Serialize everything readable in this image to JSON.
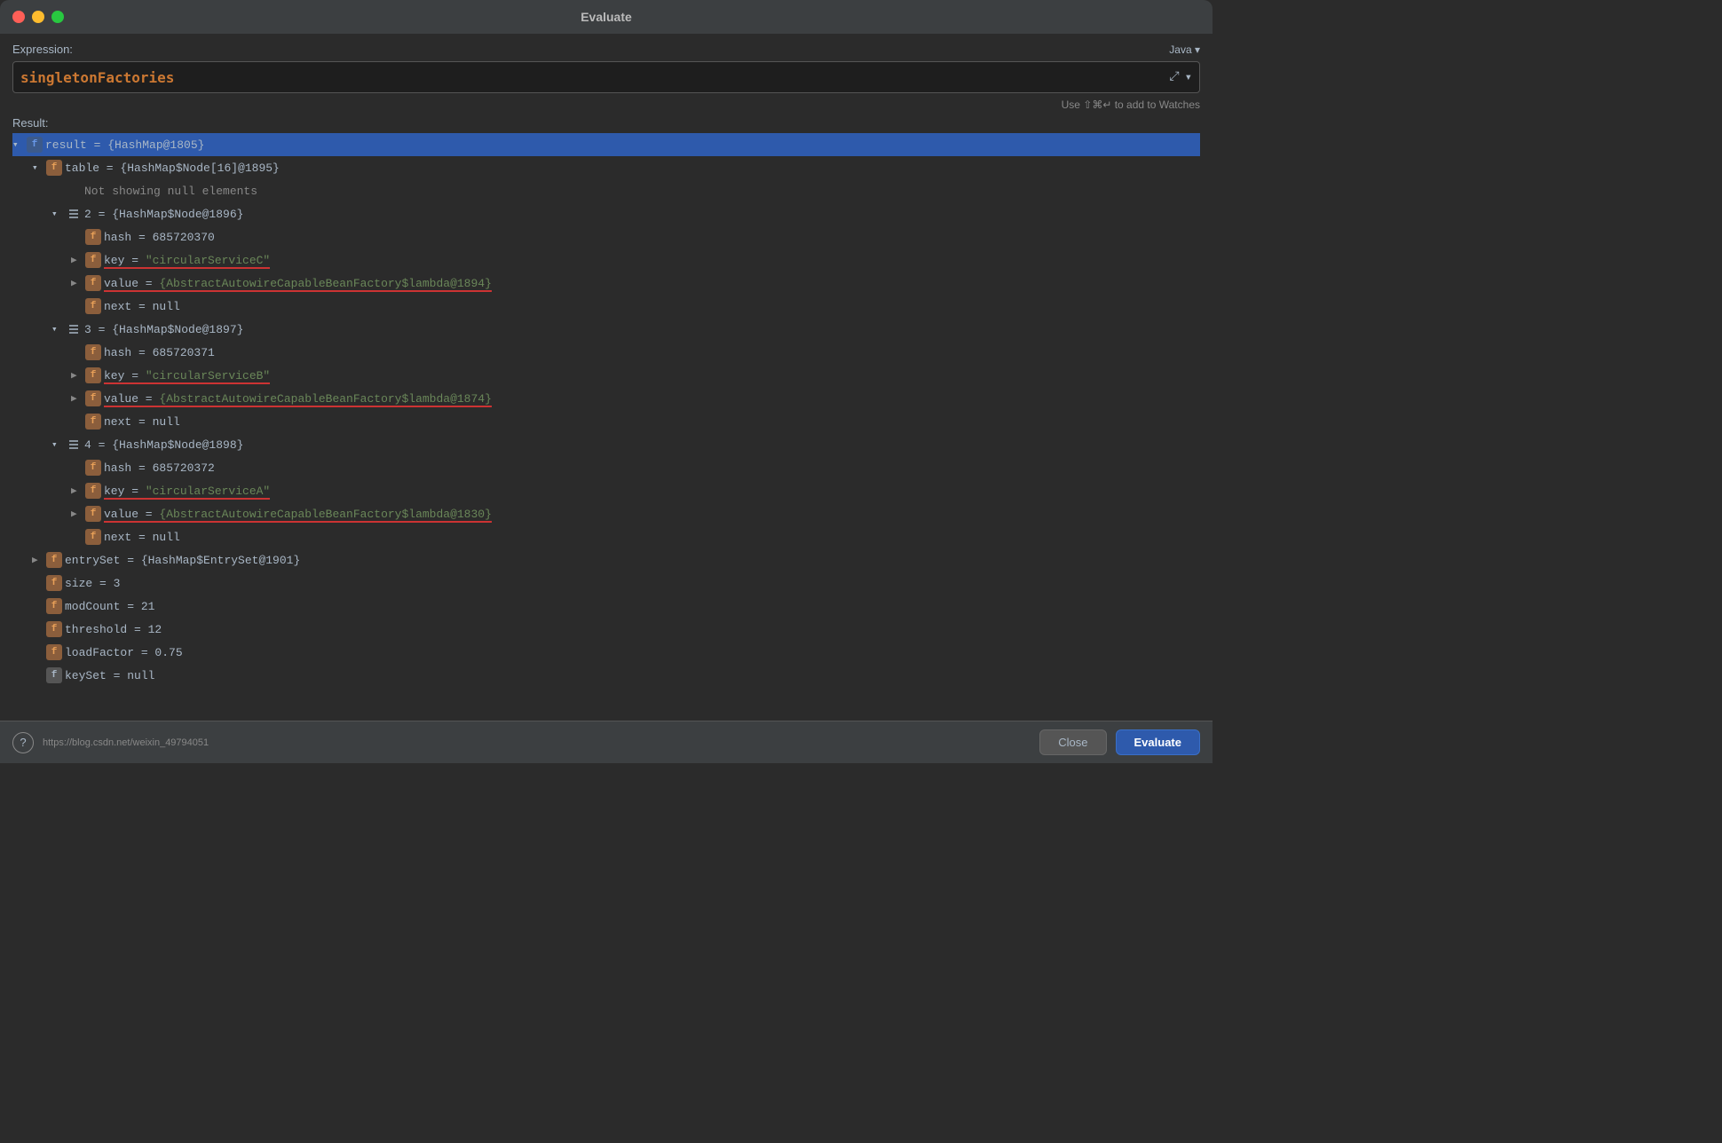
{
  "window": {
    "title": "Evaluate"
  },
  "controls": {
    "close_label": "",
    "minimize_label": "",
    "maximize_label": ""
  },
  "expression": {
    "label": "Expression:",
    "value": "singletonFactories",
    "language": "Java ▾",
    "watches_hint": "Use ⇧⌘↵ to add to Watches"
  },
  "result": {
    "label": "Result:",
    "tree": [
      {
        "id": "root",
        "indent": 0,
        "expanded": true,
        "selected": true,
        "icon": "f-blue",
        "text": "result = {HashMap@1805}",
        "has_arrow": true
      },
      {
        "id": "table",
        "indent": 1,
        "expanded": true,
        "icon": "f-orange",
        "text": "table = {HashMap$Node[16]@1895}",
        "has_arrow": true
      },
      {
        "id": "null_notice",
        "indent": 2,
        "expanded": false,
        "icon": "none",
        "text": "Not showing null elements",
        "has_arrow": false
      },
      {
        "id": "node2",
        "indent": 2,
        "expanded": true,
        "icon": "list",
        "text": "2 = {HashMap$Node@1896}",
        "has_arrow": true
      },
      {
        "id": "node2_hash",
        "indent": 3,
        "icon": "f-orange",
        "text": "hash = 685720370",
        "has_arrow": false
      },
      {
        "id": "node2_key",
        "indent": 3,
        "icon": "f-orange-underline",
        "text_key": "key",
        "text_value": "\"circularServiceC\"",
        "has_arrow": true,
        "underline": true
      },
      {
        "id": "node2_value",
        "indent": 3,
        "icon": "f-orange-underline",
        "text_key": "value",
        "text_value": "{AbstractAutowireCapableBeanFactory$lambda@1894}",
        "has_arrow": true,
        "underline": true
      },
      {
        "id": "node2_next",
        "indent": 3,
        "icon": "f-orange",
        "text": "next = null",
        "has_arrow": false
      },
      {
        "id": "node3",
        "indent": 2,
        "expanded": true,
        "icon": "list",
        "text": "3 = {HashMap$Node@1897}",
        "has_arrow": true
      },
      {
        "id": "node3_hash",
        "indent": 3,
        "icon": "f-orange",
        "text": "hash = 685720371",
        "has_arrow": false
      },
      {
        "id": "node3_key",
        "indent": 3,
        "icon": "f-orange-underline",
        "text_key": "key",
        "text_value": "\"circularServiceB\"",
        "has_arrow": true,
        "underline": true
      },
      {
        "id": "node3_value",
        "indent": 3,
        "icon": "f-orange-underline",
        "text_key": "value",
        "text_value": "{AbstractAutowireCapableBeanFactory$lambda@1874}",
        "has_arrow": true,
        "underline": true
      },
      {
        "id": "node3_next",
        "indent": 3,
        "icon": "f-orange",
        "text": "next = null",
        "has_arrow": false
      },
      {
        "id": "node4",
        "indent": 2,
        "expanded": true,
        "icon": "list",
        "text": "4 = {HashMap$Node@1898}",
        "has_arrow": true
      },
      {
        "id": "node4_hash",
        "indent": 3,
        "icon": "f-orange",
        "text": "hash = 685720372",
        "has_arrow": false
      },
      {
        "id": "node4_key",
        "indent": 3,
        "icon": "f-orange-underline",
        "text_key": "key",
        "text_value": "\"circularServiceA\"",
        "has_arrow": true,
        "underline": true
      },
      {
        "id": "node4_value",
        "indent": 3,
        "icon": "f-orange-underline",
        "text_key": "value",
        "text_value": "{AbstractAutowireCapableBeanFactory$lambda@1830}",
        "has_arrow": true,
        "underline": true
      },
      {
        "id": "node4_next",
        "indent": 3,
        "icon": "f-orange",
        "text": "next = null",
        "has_arrow": false
      },
      {
        "id": "entrySet",
        "indent": 1,
        "icon": "f-orange",
        "text": "entrySet = {HashMap$EntrySet@1901}",
        "has_arrow": true
      },
      {
        "id": "size",
        "indent": 1,
        "icon": "f-orange",
        "text": "size = 3",
        "has_arrow": false
      },
      {
        "id": "modCount",
        "indent": 1,
        "icon": "f-orange",
        "text": "modCount = 21",
        "has_arrow": false
      },
      {
        "id": "threshold",
        "indent": 1,
        "icon": "f-orange",
        "text": "threshold = 12",
        "has_arrow": false
      },
      {
        "id": "loadFactor",
        "indent": 1,
        "icon": "f-orange",
        "text": "loadFactor = 0.75",
        "has_arrow": false
      },
      {
        "id": "keySet",
        "indent": 1,
        "icon": "f-gray",
        "text": "keySet = null",
        "has_arrow": false
      }
    ]
  },
  "footer": {
    "help_label": "?",
    "url": "https://blog.csdn.net/weixin_49794051",
    "close_label": "Close",
    "evaluate_label": "Evaluate"
  }
}
